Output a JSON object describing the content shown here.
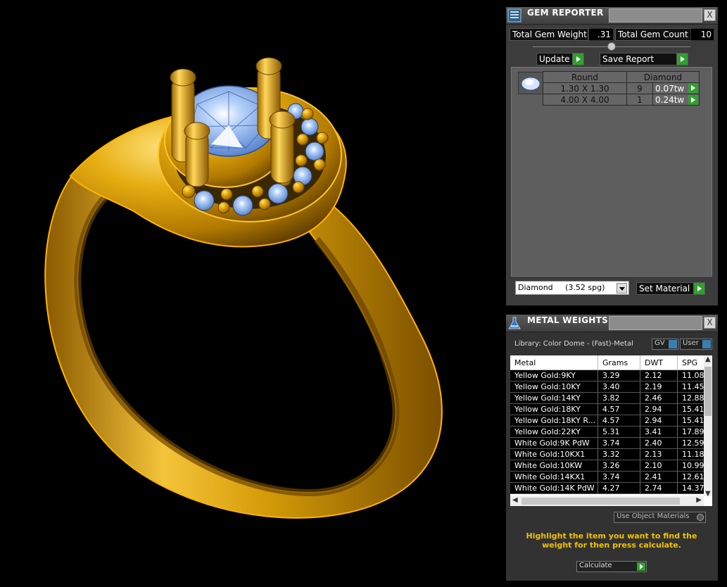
{
  "gem_reporter": {
    "title": "GEM REPORTER",
    "close": "X",
    "total_gem_weight_label": "Total Gem Weight",
    "total_gem_weight_value": ".31",
    "total_gem_count_label": "Total Gem Count",
    "total_gem_count_value": "10",
    "update_label": "Update",
    "save_report_label": "Save Report",
    "table": {
      "headers": [
        "Round",
        "Diamond"
      ],
      "rows": [
        {
          "size": "1.30 X 1.30",
          "count": "9",
          "weight": "0.07tw"
        },
        {
          "size": "4.00 X 4.00",
          "count": "1",
          "weight": "0.24tw"
        }
      ]
    },
    "material_select": "Diamond     (3.52 spg)",
    "set_material_label": "Set Material"
  },
  "metal_weights": {
    "title": "METAL WEIGHTS",
    "close": "X",
    "library": "Library: Color Dome - (Fast)-Metal",
    "gv_label": "GV",
    "user_label": "User",
    "columns": [
      "Metal",
      "Grams",
      "DWT",
      "SPG"
    ],
    "rows": [
      [
        "Yellow Gold:9KY",
        "3.29",
        "2.12",
        "11.08"
      ],
      [
        "Yellow Gold:10KY",
        "3.40",
        "2.19",
        "11.45"
      ],
      [
        "Yellow Gold:14KY",
        "3.82",
        "2.46",
        "12.88"
      ],
      [
        "Yellow Gold:18KY",
        "4.57",
        "2.94",
        "15.41"
      ],
      [
        "Yellow Gold:18KY R...",
        "4.57",
        "2.94",
        "15.41"
      ],
      [
        "Yellow Gold:22KY",
        "5.31",
        "3.41",
        "17.89"
      ],
      [
        "White Gold:9K PdW",
        "3.74",
        "2.40",
        "12.59"
      ],
      [
        "White Gold:10KX1",
        "3.32",
        "2.13",
        "11.18"
      ],
      [
        "White Gold:10KW",
        "3.26",
        "2.10",
        "10.99"
      ],
      [
        "White Gold:14KX1",
        "3.74",
        "2.41",
        "12.61"
      ],
      [
        "White Gold:14K PdW",
        "4.27",
        "2.74",
        "14.37"
      ]
    ],
    "use_object_materials": "Use Object Materials",
    "hint": "Highlight the item you want to find the weight for then press calculate.",
    "calculate_label": "Calculate"
  },
  "colors": {
    "gold": "#d9a10a",
    "gem": "#8ab4ee",
    "hint": "#f2c200",
    "panel": "#3c3c3c",
    "accent_green": "#2fa12f"
  }
}
